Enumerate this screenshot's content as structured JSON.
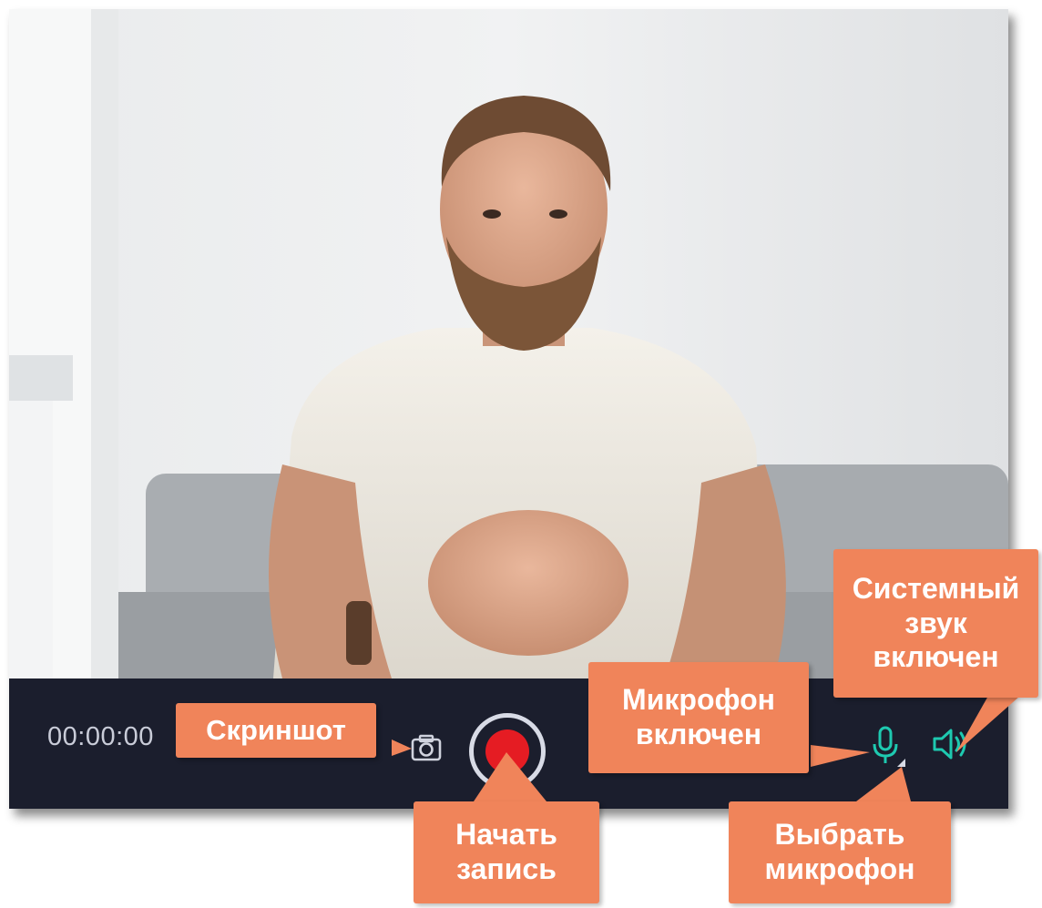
{
  "recorder": {
    "timer": "00:00:00"
  },
  "icons": {
    "screenshot": "camera-icon",
    "record": "record-icon",
    "microphone": "microphone-icon",
    "mic_select": "dropdown-arrow-icon",
    "system_sound": "speaker-icon"
  },
  "colors": {
    "control_bar": "#1b1e2d",
    "record": "#e51c23",
    "accent": "#1ec9b0",
    "callout": "#f0845a"
  },
  "callouts": {
    "screenshot": [
      "Скриншот"
    ],
    "start_record": [
      "Начать",
      "запись"
    ],
    "mic_on": [
      "Микрофон",
      "включен"
    ],
    "select_mic": [
      "Выбрать",
      "микрофон"
    ],
    "system_sound": [
      "Системный",
      "звук",
      "включен"
    ]
  }
}
